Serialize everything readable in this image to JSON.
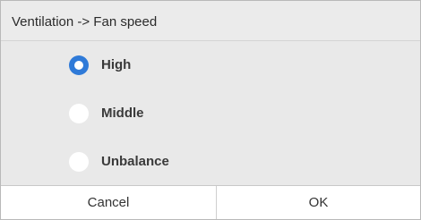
{
  "dialog": {
    "title": "Ventilation -> Fan speed",
    "options": [
      {
        "label": "High",
        "checked": true
      },
      {
        "label": "Middle",
        "checked": false
      },
      {
        "label": "Unbalance",
        "checked": false
      }
    ],
    "buttons": {
      "cancel_label": "Cancel",
      "ok_label": "OK"
    },
    "colors": {
      "accent": "#2f7ad8",
      "options_background": "#e9e9e9",
      "title_background": "#ebebeb"
    }
  }
}
